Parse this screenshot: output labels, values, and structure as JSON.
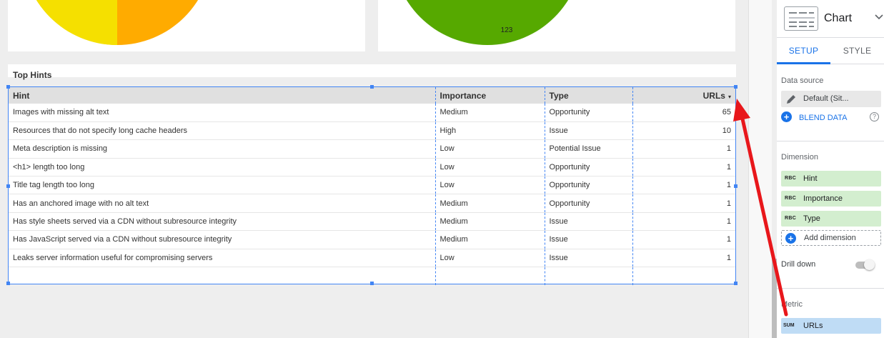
{
  "report": {
    "pie_right_value": "123",
    "hints_title": "Top Hints",
    "table": {
      "columns": [
        "Hint",
        "Importance",
        "Type",
        "URLs"
      ],
      "sort_indicator": "▾",
      "rows": [
        [
          "Images with missing alt text",
          "Medium",
          "Opportunity",
          "65"
        ],
        [
          "Resources that do not specify long cache headers",
          "High",
          "Issue",
          "10"
        ],
        [
          "Meta description is missing",
          "Low",
          "Potential Issue",
          "1"
        ],
        [
          "<h1> length too long",
          "Low",
          "Opportunity",
          "1"
        ],
        [
          "Title tag length too long",
          "Low",
          "Opportunity",
          "1"
        ],
        [
          "Has an anchored image with no alt text",
          "Medium",
          "Opportunity",
          "1"
        ],
        [
          "Has style sheets served via a CDN without subresource integrity",
          "Medium",
          "Issue",
          "1"
        ],
        [
          "Has JavaScript served via a CDN without subresource integrity",
          "Medium",
          "Issue",
          "1"
        ],
        [
          "Leaks server information useful for compromising servers",
          "Low",
          "Issue",
          "1"
        ]
      ]
    }
  },
  "panel": {
    "title": "Chart",
    "chevron_icon": "chevron-down-icon",
    "tabs": {
      "setup": "SETUP",
      "style": "STYLE"
    },
    "data_source_label": "Data source",
    "data_source_value": "Default (Sit...",
    "blend_data": "BLEND DATA",
    "help_glyph": "?",
    "dimension_label": "Dimension",
    "dimension_type_badge": "RBC",
    "dimensions": [
      "Hint",
      "Importance",
      "Type"
    ],
    "add_dimension": "Add dimension",
    "drill_down_label": "Drill down",
    "drill_down_on": false,
    "metric_label": "Metric",
    "metric_agg": "SUM",
    "metric": "URLs"
  },
  "colors": {
    "accent": "#1a73e8",
    "selection": "#4285f4",
    "dimension_chip": "#d3eecf",
    "metric_chip": "#bfdcf5",
    "arrow": "#e8171b",
    "pie_yellow": "#f5e000",
    "pie_orange": "#ffab00",
    "pie_green": "#56a900"
  }
}
